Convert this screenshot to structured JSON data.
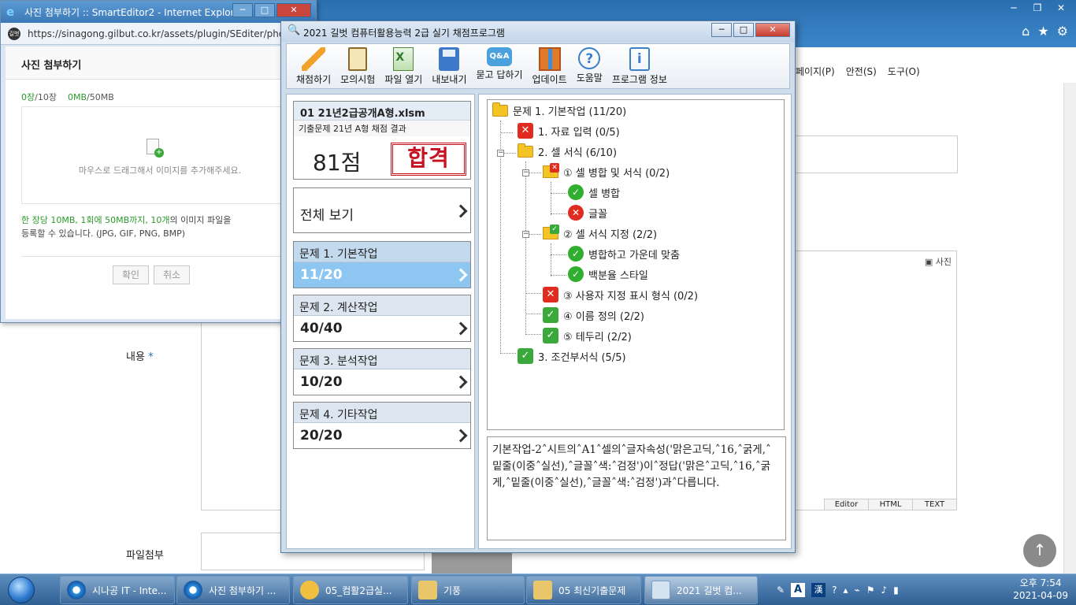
{
  "browser": {
    "cmd_items": [
      "페이지(P)",
      "안전(S)",
      "도구(O)"
    ],
    "winbtns": [
      "─",
      "❐",
      "✕"
    ],
    "icons": [
      "⌂",
      "★",
      "⚙"
    ]
  },
  "page": {
    "content_label": "내용",
    "required_mark": "*",
    "file_label": "파일첨부",
    "editor_photo": "사진",
    "editor_tabs": [
      "Editor",
      "HTML",
      "TEXT"
    ]
  },
  "popup": {
    "title": "사진 첨부하기 :: SmartEditor2 - Internet Explorer",
    "url": "https://sinagong.gilbut.co.kr/assets/plugin/SEditer/photo_uploader/",
    "header": "사진 첨부하기",
    "count_used": "0장",
    "count_total": "/10장",
    "size_used": "0MB",
    "size_total": "/50MB",
    "drop_text": "마우스로 드래그해서 이미지를 추가해주세요.",
    "note_line1_green": "한 장당 10MB, 1회에 50MB까지, 10개",
    "note_line1_rest": "의 이미지 파일을",
    "note_line2": "등록할 수 있습니다. (JPG, GIF, PNG, BMP)",
    "ok_label": "확인",
    "cancel_label": "취소"
  },
  "app": {
    "title": "2021 길벗 컴퓨터활용능력 2급 실기 채점프로그램",
    "toolbar": [
      "채점하기",
      "모의시험",
      "파일 열기",
      "내보내기",
      "묻고 답하기",
      "업데이트",
      "도움말",
      "프로그램 정보"
    ],
    "qa_icon_text": "Q&A",
    "result": {
      "file": "01 21년2급공개A형.xlsm",
      "desc": "기출문제 21년 A형 채점 결과",
      "score": "81점",
      "stamp": "합격"
    },
    "view_all": "전체 보기",
    "problems": [
      {
        "title": "문제 1. 기본작업",
        "score": "11/20",
        "active": true
      },
      {
        "title": "문제 2. 계산작업",
        "score": "40/40",
        "active": false
      },
      {
        "title": "문제 3. 분석작업",
        "score": "10/20",
        "active": false
      },
      {
        "title": "문제 4. 기타작업",
        "score": "20/20",
        "active": false
      }
    ],
    "tree": {
      "root": "문제 1. 기본작업 (11/20)",
      "n1": "1. 자료 입력 (0/5)",
      "n2": "2. 셀 서식 (6/10)",
      "n2_1": "① 셀 병합 및 서식 (0/2)",
      "n2_1_a": "셀 병합",
      "n2_1_b": "글꼴",
      "n2_2": "② 셀 서식 지정 (2/2)",
      "n2_2_a": "병합하고 가운데 맞춤",
      "n2_2_b": "백분율 스타일",
      "n2_3": "③ 사용자 지정 표시 형식 (0/2)",
      "n2_4": "④ 이름 정의 (2/2)",
      "n2_5": "⑤ 테두리 (2/2)",
      "n3": "3. 조건부서식 (5/5)"
    },
    "message": "기본작업-2˄시트의˄A1˄셀의˄글자속성('맑은고딕,˄16,˄굵게,˄밑줄(이중˄실선),˄글꼴˄색:˄검정')이˄정답('맑은˄고딕,˄16,˄굵게,˄밑줄(이중˄실선),˄글꼴˄색:˄검정')과˄다릅니다."
  },
  "taskbar": {
    "tasks": [
      "시나공 IT - Inte...",
      "사진 첨부하기 ...",
      "05_컴활2급실...",
      "기풍",
      "05 최신기출문제",
      "2021 길벗 컴..."
    ],
    "ime_a": "A",
    "ime_h": "漢",
    "time": "오후 7:54",
    "date": "2021-04-09"
  }
}
